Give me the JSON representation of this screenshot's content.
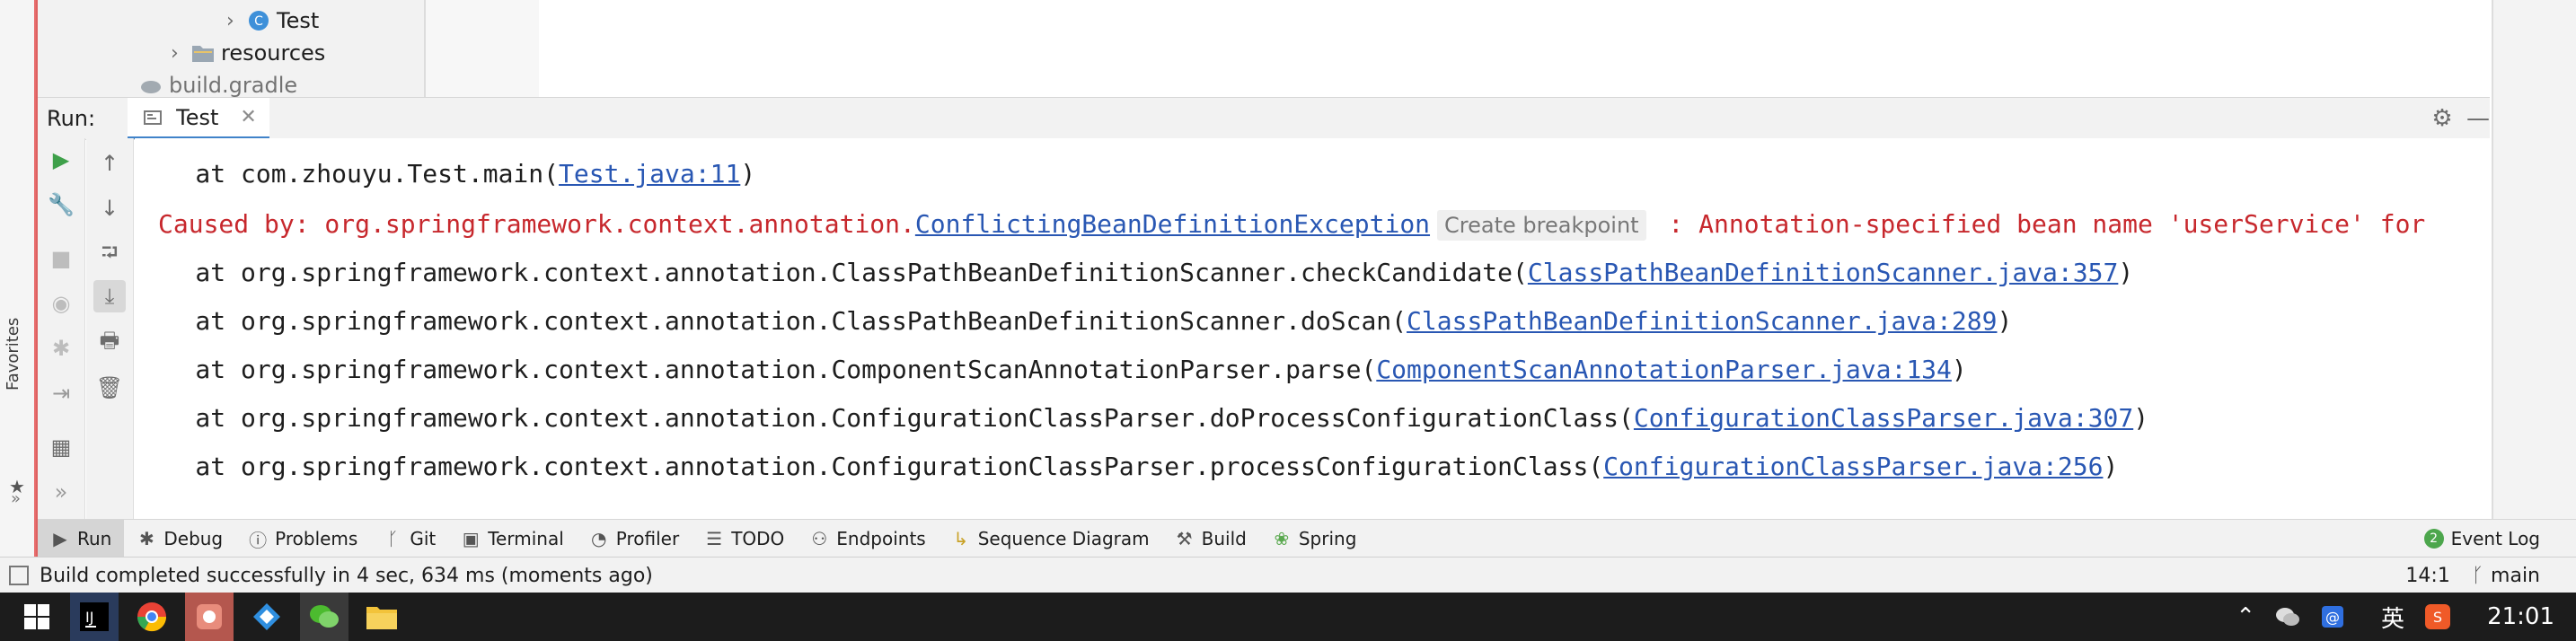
{
  "project_tree": {
    "items": [
      {
        "label": "Test"
      },
      {
        "label": "resources"
      },
      {
        "label": "build.gradle"
      }
    ]
  },
  "run_panel": {
    "label": "Run:",
    "tab_label": "Test"
  },
  "console": {
    "lines": [
      {
        "prefix": "    at com.zhouyu.Test.main(",
        "link": "Test.java:11",
        "suffix": ")"
      },
      {
        "prefix": "Caused by: org.springframework.context.annotation.",
        "link": "ConflictingBeanDefinitionException",
        "hint": "Create breakpoint",
        "suffix": " : Annotation-specified bean name 'userService' for"
      },
      {
        "prefix": "    at org.springframework.context.annotation.ClassPathBeanDefinitionScanner.checkCandidate(",
        "link": "ClassPathBeanDefinitionScanner.java:357",
        "suffix": ")"
      },
      {
        "prefix": "    at org.springframework.context.annotation.ClassPathBeanDefinitionScanner.doScan(",
        "link": "ClassPathBeanDefinitionScanner.java:289",
        "suffix": ")"
      },
      {
        "prefix": "    at org.springframework.context.annotation.ComponentScanAnnotationParser.parse(",
        "link": "ComponentScanAnnotationParser.java:134",
        "suffix": ")"
      },
      {
        "prefix": "    at org.springframework.context.annotation.ConfigurationClassParser.doProcessConfigurationClass(",
        "link": "ConfigurationClassParser.java:307",
        "suffix": ")"
      },
      {
        "prefix": "    at org.springframework.context.annotation.ConfigurationClassParser.processConfigurationClass(",
        "link": "ConfigurationClassParser.java:256",
        "suffix": ")"
      }
    ]
  },
  "side": {
    "favorites_label": "Favorites"
  },
  "tool_windows": [
    {
      "label": "Run",
      "icon": "play-icon"
    },
    {
      "label": "Debug",
      "icon": "bug-icon"
    },
    {
      "label": "Problems",
      "icon": "info-icon"
    },
    {
      "label": "Git",
      "icon": "git-icon"
    },
    {
      "label": "Terminal",
      "icon": "terminal-icon"
    },
    {
      "label": "Profiler",
      "icon": "profiler-icon"
    },
    {
      "label": "TODO",
      "icon": "list-icon"
    },
    {
      "label": "Endpoints",
      "icon": "endpoints-icon"
    },
    {
      "label": "Sequence Diagram",
      "icon": "sequence-icon"
    },
    {
      "label": "Build",
      "icon": "hammer-icon"
    },
    {
      "label": "Spring",
      "icon": "spring-icon"
    }
  ],
  "event_log": {
    "label": "Event Log",
    "badge": "2"
  },
  "status_bar": {
    "message": "Build completed successfully in 4 sec, 634 ms (moments ago)",
    "position": "14:1",
    "branch": "main"
  },
  "taskbar": {
    "ime": "英",
    "clock": "21:01"
  },
  "colors": {
    "exception_red": "#c7282d",
    "link_blue": "#2957b3",
    "accent": "#4083c9"
  }
}
